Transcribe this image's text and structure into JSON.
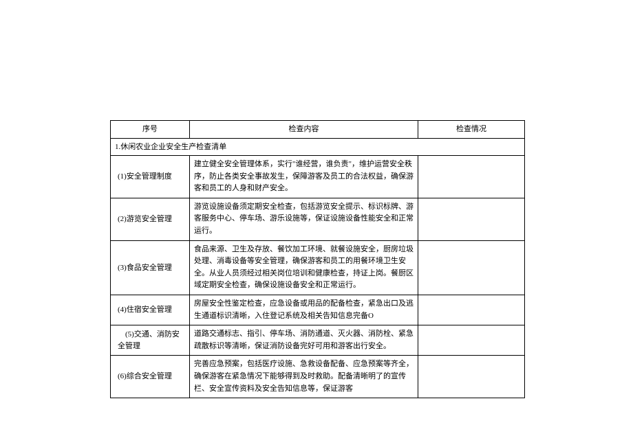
{
  "headers": {
    "col1": "序号",
    "col2": "检查内容",
    "col3": "检查情况"
  },
  "sectionTitle": "1.休闲农业企业安全生产检查清单",
  "rows": [
    {
      "label": "(1)安全管理制度",
      "content": "建立健全安全管理体系，实行\"谁经营，谁负责\"，维护运营安全秩序，防止各类安全事故发生，保障游客及员工的合法权益，确保游客和员工的人身和财产安全。"
    },
    {
      "label": "(2)游览安全管理",
      "content": "游览设施设备须定期安全检查，包括游览安全提示、标识标牌、游客服务中心、停车场、游乐设施等，保证设施设备性能安全和正常运行。"
    },
    {
      "label": "(3)食品安全管理",
      "content": "食品来源、卫生及存放、餐饮加工环境、就餐设施安全，厨房垃圾处理、消毒设备等安全管理，确保游客和员工的用餐环境卫生安全。从业人员须经过相关岗位培训和健康检查，持证上岗。餐厨区域定期安全检查，确保设施设备安全和正常运行。"
    },
    {
      "label": "(4)住宿安全管理",
      "content": "房屋安全性鉴定检查，应急设备或用品的配备检查，紧急出口及逃生通道标识清晰，入住登记系统及相关告知信息完备O"
    },
    {
      "label": "　(5)交通、消防安全管理",
      "content": "道路交通标志、指引、停车场、消防通道、灭火器、消防栓、紧急疏散标识等清晰，保证消防设备完好可用和游客出行安全。"
    },
    {
      "label": "(6)综合安全管理",
      "content": "完善应急预案，包括医疗设施、急救设备配备、应急预案等齐全，确保游客在紧急情况下能够得到及时救助。配备清晰明了的宣传栏、安全宣传资料及安全告知信息等，保证游客"
    }
  ]
}
